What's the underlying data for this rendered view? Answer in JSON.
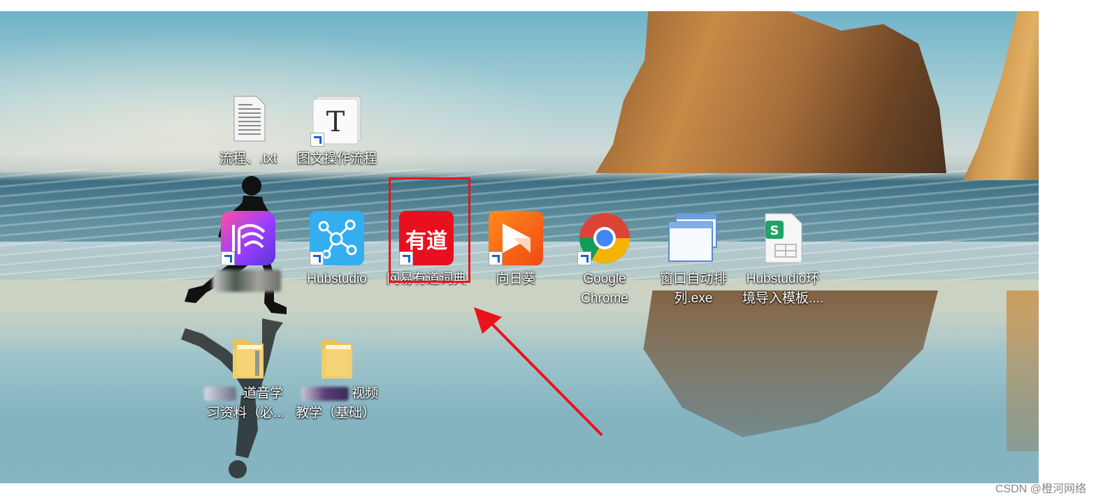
{
  "desktop": {
    "icons": [
      {
        "name": "txt-file",
        "label_lines": [
          "流程、.txt"
        ]
      },
      {
        "name": "doc-shortcut",
        "label_lines": [
          "图文操作流程"
        ]
      },
      {
        "name": "app-blurred",
        "label_lines": [
          ""
        ]
      },
      {
        "name": "hubstudio",
        "label_lines": [
          "Hubstudio"
        ]
      },
      {
        "name": "youdao-dict",
        "label_lines": [
          "网易有道词典"
        ]
      },
      {
        "name": "xiangrikui",
        "label_lines": [
          "向日葵"
        ]
      },
      {
        "name": "google-chrome",
        "label_lines": [
          "Google",
          "Chrome"
        ]
      },
      {
        "name": "window-arrange",
        "label_lines": [
          "窗口自动排",
          "列.exe"
        ]
      },
      {
        "name": "hubstudio-template",
        "label_lines": [
          "Hubstudio环",
          "境导入模板...."
        ]
      },
      {
        "name": "folder-1",
        "label_lines": [
          "道音学",
          "习资料（必..."
        ]
      },
      {
        "name": "folder-2",
        "label_lines": [
          "视频",
          "教学（基础）"
        ]
      }
    ],
    "glyphs": {
      "doc_letter": "T",
      "youdao_text": "有道",
      "sheet_letter": "S"
    }
  },
  "annotation": {
    "box_color": "#e8141a",
    "arrow_color": "#e8141a"
  },
  "watermark": "CSDN @橙河网络"
}
